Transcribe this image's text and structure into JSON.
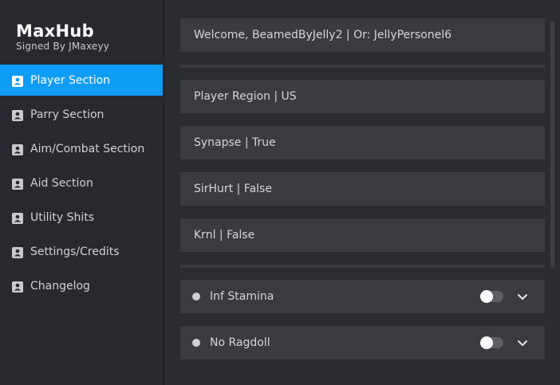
{
  "brand": {
    "title": "MaxHub",
    "subtitle": "Signed By JMaxeyy"
  },
  "sidebar": {
    "items": [
      {
        "label": "Player Section",
        "icon": "contact-icon",
        "active": true
      },
      {
        "label": "Parry Section",
        "icon": "contact-icon",
        "active": false
      },
      {
        "label": "Aim/Combat Section",
        "icon": "contact-icon",
        "active": false
      },
      {
        "label": "Aid Section",
        "icon": "contact-icon",
        "active": false
      },
      {
        "label": "Utility Shits",
        "icon": "contact-icon",
        "active": false
      },
      {
        "label": "Settings/Credits",
        "icon": "contact-icon",
        "active": false
      },
      {
        "label": "Changelog",
        "icon": "contact-icon",
        "active": false
      }
    ]
  },
  "main": {
    "welcome": "Welcome, BeamedByJelly2 | Or: JellyPersonel6",
    "info": [
      "Player Region | US",
      "Synapse | True",
      "SirHurt | False",
      "Krnl | False"
    ],
    "toggles": [
      {
        "label": "Inf Stamina",
        "on": false
      },
      {
        "label": "No Ragdoll",
        "on": false
      }
    ]
  },
  "colors": {
    "accent": "#0f9cf5",
    "sidebar_bg": "#28292e",
    "content_bg": "#2b2c31",
    "card_bg": "#3a3b41"
  }
}
